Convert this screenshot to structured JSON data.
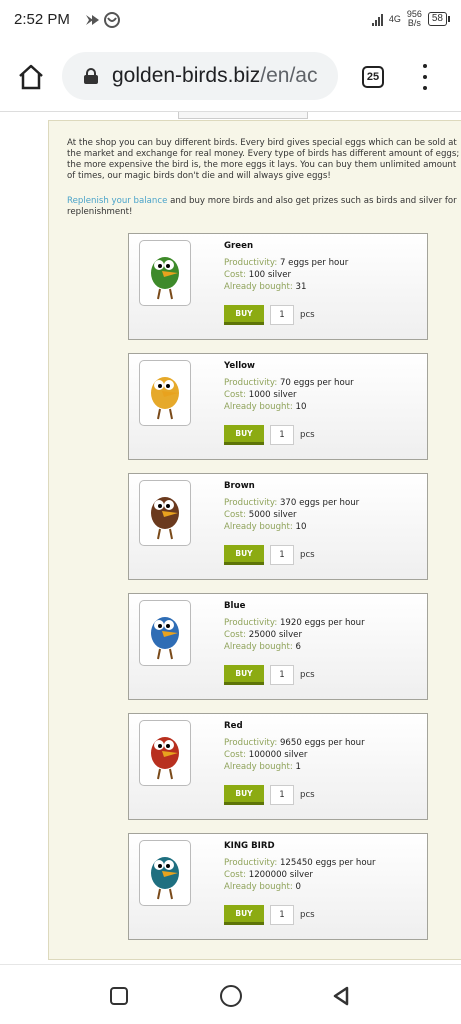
{
  "status": {
    "time": "2:52 PM",
    "network": "4G",
    "speed_value": "956",
    "speed_unit": "B/s",
    "battery": "58"
  },
  "browser": {
    "url_domain": "golden-birds.biz",
    "url_path": "/en/ac",
    "tab_count": "25"
  },
  "page": {
    "intro": "At the shop you can buy different birds. Every bird gives special eggs which can be sold at the market and exchange for real money. Every type of birds has different amount of eggs; the more expensive the bird is, the more eggs it lays. You can buy them unlimited amount of times, our magic birds don't die and will always give eggs!",
    "replenish_link": "Replenish your balance",
    "replenish_rest": " and buy more birds and also get prizes such as birds and silver for replenishment!",
    "buy_label": "BUY",
    "pcs_label": "pcs",
    "productivity_label": "Productivity:",
    "cost_label": "Cost:",
    "bought_label": "Already bought:"
  },
  "birds": [
    {
      "name": "Green",
      "productivity": "7 eggs per hour",
      "cost": "100 silver",
      "bought": "31",
      "qty": "1",
      "color": "#3e8a2a",
      "icon": "green-parrot"
    },
    {
      "name": "Yellow",
      "productivity": "70 eggs per hour",
      "cost": "1000 silver",
      "bought": "10",
      "qty": "1",
      "color": "#e6a92a",
      "icon": "yellow-bird"
    },
    {
      "name": "Brown",
      "productivity": "370 eggs per hour",
      "cost": "5000 silver",
      "bought": "10",
      "qty": "1",
      "color": "#6b3a1e",
      "icon": "brown-bird"
    },
    {
      "name": "Blue",
      "productivity": "1920 eggs per hour",
      "cost": "25000 silver",
      "bought": "6",
      "qty": "1",
      "color": "#2f6db5",
      "icon": "blue-bird"
    },
    {
      "name": "Red",
      "productivity": "9650 eggs per hour",
      "cost": "100000 silver",
      "bought": "1",
      "qty": "1",
      "color": "#b8301f",
      "icon": "red-bird"
    },
    {
      "name": "KING BIRD",
      "productivity": "125450 eggs per hour",
      "cost": "1200000 silver",
      "bought": "0",
      "qty": "1",
      "color": "#1f6f80",
      "icon": "king-bird"
    }
  ]
}
